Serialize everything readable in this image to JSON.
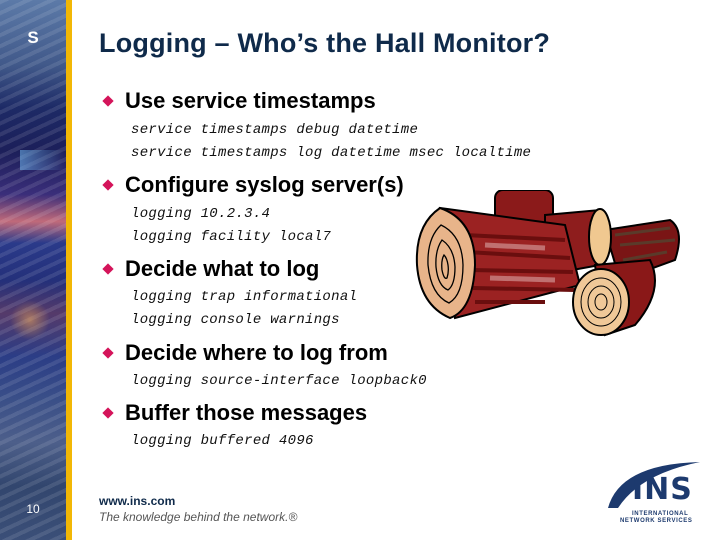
{
  "sidebar": {
    "letter": "S",
    "page_number": "10"
  },
  "title": "Logging – Who’s the Hall Monitor?",
  "sections": [
    {
      "heading": "Use service timestamps",
      "commands": [
        "service timestamps debug datetime",
        "service timestamps log datetime msec localtime"
      ]
    },
    {
      "heading": "Configure syslog server(s)",
      "commands": [
        "logging 10.2.3.4",
        "logging facility local7"
      ]
    },
    {
      "heading": "Decide what to log",
      "commands": [
        "logging trap informational",
        "logging console warnings"
      ]
    },
    {
      "heading": "Decide where to log from",
      "commands": [
        "logging source-interface loopback0"
      ]
    },
    {
      "heading": "Buffer those messages",
      "commands": [
        "logging buffered 4096"
      ]
    }
  ],
  "footer": {
    "url": "www.ins.com",
    "tagline": "The knowledge behind the network.®"
  },
  "logo": {
    "letters": "INS",
    "line1": "INTERNATIONAL",
    "line2": "NETWORK SERVICES"
  },
  "colors": {
    "title": "#0f2a4a",
    "bullet": "#d4145a",
    "stripe": "#f2b705",
    "logo": "#1d3a6e"
  }
}
